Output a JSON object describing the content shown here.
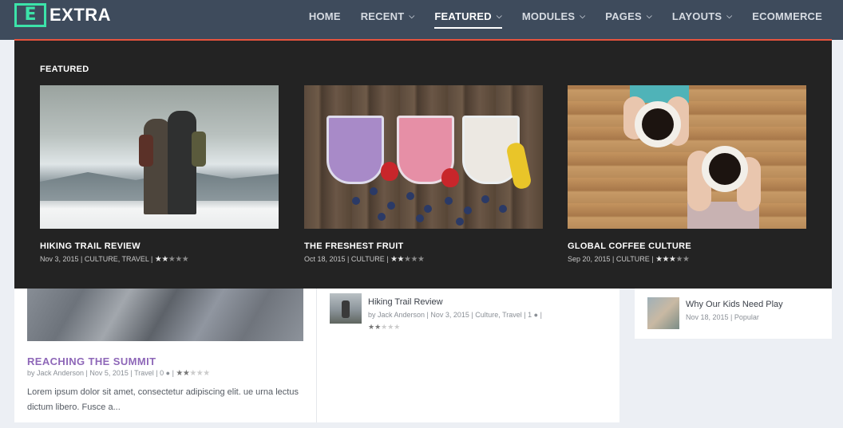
{
  "brand": {
    "logo_letter": "E",
    "name": "EXTRA",
    "accent": "#3ce3a9"
  },
  "nav": {
    "items": [
      {
        "label": "HOME",
        "has_dropdown": false
      },
      {
        "label": "RECENT",
        "has_dropdown": true
      },
      {
        "label": "FEATURED",
        "has_dropdown": true,
        "active": true
      },
      {
        "label": "MODULES",
        "has_dropdown": true
      },
      {
        "label": "PAGES",
        "has_dropdown": true
      },
      {
        "label": "LAYOUTS",
        "has_dropdown": true
      },
      {
        "label": "ECOMMERCE",
        "has_dropdown": false
      }
    ]
  },
  "mega_menu": {
    "heading": "FEATURED",
    "accent": "#e8533d",
    "posts": [
      {
        "title": "HIKING TRAIL REVIEW",
        "meta": "Nov 3, 2015 | CULTURE, TRAVEL |",
        "rating": 2.5,
        "image": "hikers-on-mountain"
      },
      {
        "title": "THE FRESHEST FRUIT",
        "meta": "Oct 18, 2015 | CULTURE |",
        "rating": 2.5,
        "image": "smoothies-and-berries"
      },
      {
        "title": "GLOBAL COFFEE CULTURE",
        "meta": "Sep 20, 2015 | CULTURE |",
        "rating": 3.5,
        "image": "hands-holding-coffee"
      }
    ]
  },
  "content": {
    "main_post": {
      "title": "REACHING THE SUMMIT",
      "meta": "by Jack Anderson | Nov 5, 2015 | Travel | 0",
      "rating": 2.5,
      "excerpt": "Lorem ipsum dolor sit amet, consectetur adipiscing elit. ue urna lectus dictum libero. Fusce a..."
    },
    "side_post": {
      "title": "Hiking Trail Review",
      "meta": "by Jack Anderson | Nov 3, 2015 | Culture, Travel | 1",
      "rating": 2.5
    },
    "widget_post": {
      "title": "Why Our Kids Need Play",
      "meta": "Nov 18, 2015 | Popular"
    },
    "title_color": "#8e67b8"
  }
}
